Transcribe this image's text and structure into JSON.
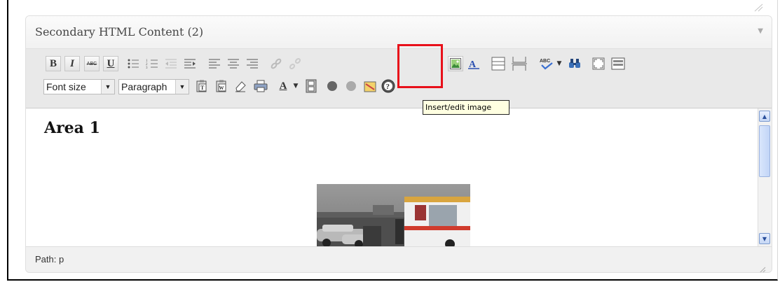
{
  "panel": {
    "title": "Secondary HTML Content (2)"
  },
  "toolbar": {
    "row1": [
      {
        "name": "bold-button",
        "icon": "bold-icon",
        "glyph": "B"
      },
      {
        "name": "italic-button",
        "icon": "italic-icon",
        "glyph": "I"
      },
      {
        "name": "strikethrough-button",
        "icon": "strikethrough-icon",
        "glyph": "ABC"
      },
      {
        "name": "underline-button",
        "icon": "underline-icon",
        "glyph": "U"
      },
      {
        "name": "bullet-list-button",
        "icon": "bullet-list-icon"
      },
      {
        "name": "numbered-list-button",
        "icon": "numbered-list-icon"
      },
      {
        "name": "outdent-button",
        "icon": "outdent-icon"
      },
      {
        "name": "indent-button",
        "icon": "indent-icon"
      },
      {
        "name": "align-left-button",
        "icon": "align-left-icon"
      },
      {
        "name": "align-center-button",
        "icon": "align-center-icon"
      },
      {
        "name": "align-right-button",
        "icon": "align-right-icon"
      },
      {
        "name": "insert-link-button",
        "icon": "link-icon"
      },
      {
        "name": "unlink-button",
        "icon": "unlink-icon"
      },
      {
        "name": "insert-image-button",
        "icon": "image-icon"
      },
      {
        "name": "anchor-button",
        "icon": "anchor-icon"
      },
      {
        "name": "insert-more-button",
        "icon": "page-break-icon"
      },
      {
        "name": "page-break-button",
        "icon": "page-break-icon"
      },
      {
        "name": "spellcheck-button",
        "icon": "spellcheck-icon",
        "glyph": "ABC"
      },
      {
        "name": "find-button",
        "icon": "binoculars-icon"
      },
      {
        "name": "fullscreen-button",
        "icon": "fullscreen-icon"
      },
      {
        "name": "kitchen-sink-button",
        "icon": "toolbar-toggle-icon"
      }
    ],
    "font_size_label": "Font size",
    "format_label": "Paragraph",
    "text_color_glyph": "A"
  },
  "tooltip": {
    "text": "Insert/edit image"
  },
  "editor": {
    "heading": "Area 1",
    "image": "ambulance-accident-photo"
  },
  "status": {
    "path": "Path: p"
  },
  "colors": {
    "highlight": "#e8101a",
    "tooltip_bg": "#ffffe1",
    "toolbar_bg": "#e9e9e9",
    "scrollbar": "#c6d7f5"
  }
}
